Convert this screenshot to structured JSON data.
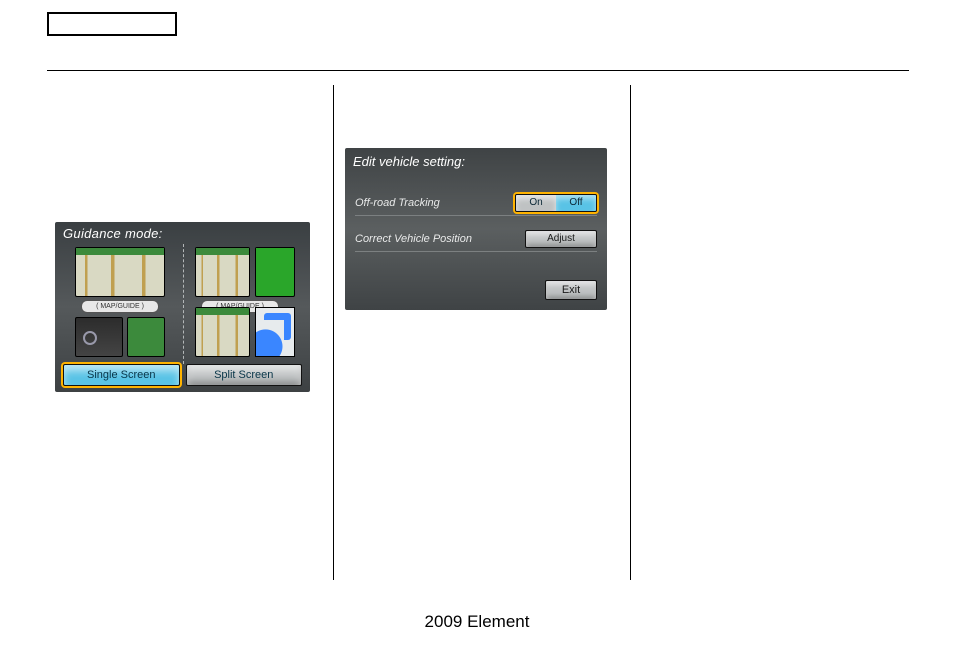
{
  "footer": "2009  Element",
  "guidance": {
    "title": "Guidance mode:",
    "pill_left": "( MAP/GUIDE )",
    "pill_right": "( MAP/GUIDE )",
    "single": "Single Screen",
    "split": "Split Screen"
  },
  "vehicle": {
    "title": "Edit vehicle setting:",
    "rowA_label": "Off-road Tracking",
    "on": "On",
    "off": "Off",
    "rowB_label": "Correct Vehicle Position",
    "adjust": "Adjust",
    "exit": "Exit"
  }
}
